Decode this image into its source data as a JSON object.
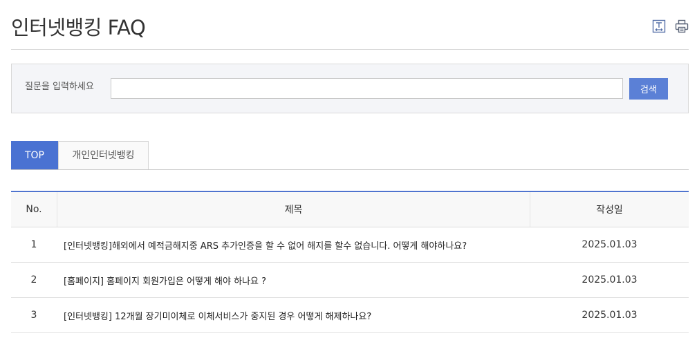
{
  "page": {
    "title": "인터넷뱅킹 FAQ"
  },
  "toolbar": {
    "text_size_icon": "text-size-icon",
    "print_icon": "printer-icon"
  },
  "search": {
    "label": "질문을 입력하세요",
    "button_label": "검색"
  },
  "tabs": [
    {
      "label": "TOP",
      "active": true
    },
    {
      "label": "개인인터넷뱅킹",
      "active": false
    }
  ],
  "table": {
    "columns": {
      "no": "No.",
      "title": "제목",
      "date": "작성일"
    },
    "rows": [
      {
        "no": "1",
        "title": "[인터넷뱅킹]해외에서 예적금해지중 ARS 추가인증을 할 수 없어 해지를 할수 없습니다. 어떻게 해야하나요?",
        "date": "2025.01.03"
      },
      {
        "no": "2",
        "title": "[홈페이지] 홈페이지 회원가입은 어떻게 해야 하나요 ?",
        "date": "2025.01.03"
      },
      {
        "no": "3",
        "title": "[인터넷뱅킹] 12개월 장기미이체로 이체서비스가 중지된 경우 어떻게 해제하나요?",
        "date": "2025.01.03"
      }
    ]
  },
  "colors": {
    "accent": "#4a72d2",
    "search_button": "#5b80d6",
    "search_background": "#f4f5f8",
    "table_header_background": "#f8f8f8",
    "table_top_border": "#4f74cf"
  }
}
